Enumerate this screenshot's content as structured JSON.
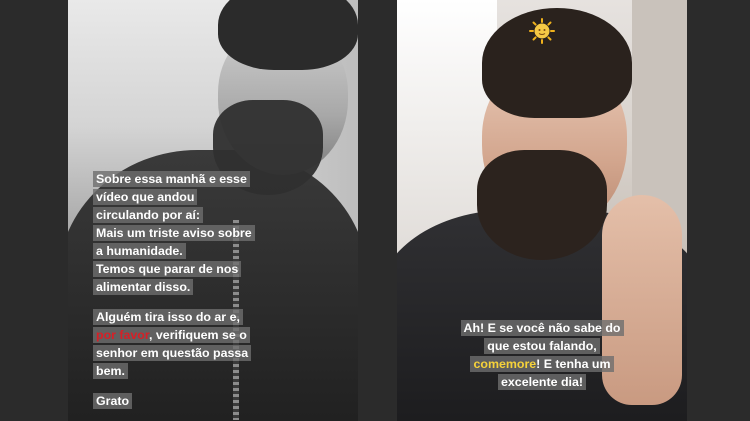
{
  "left_story": {
    "paragraph1": [
      "Sobre essa manhã e esse",
      "vídeo que andou",
      "circulando por aí:",
      "Mais um triste aviso sobre",
      "a humanidade.",
      "Temos que parar de nos",
      "alimentar disso."
    ],
    "paragraph2": {
      "line1": "Alguém tira isso do ar e,",
      "line2_highlight": "por favor",
      "line2_rest": ", verifiquem se o",
      "line3": "senhor em questão passa",
      "line4": "bem."
    },
    "signoff": "Grato"
  },
  "right_story": {
    "sticker": "sun-emoji-icon",
    "line1": "Ah! E se você não sabe do",
    "line2": "que estou falando,",
    "line3_highlight": "comemore",
    "line3_rest": "! E tenha um",
    "line4": "excelente dia!"
  },
  "colors": {
    "background": "#2b2b2b",
    "highlight_red": "#d71f26",
    "highlight_yellow": "#f6d23a",
    "caption_bg": "rgba(110,110,110,0.80)"
  }
}
